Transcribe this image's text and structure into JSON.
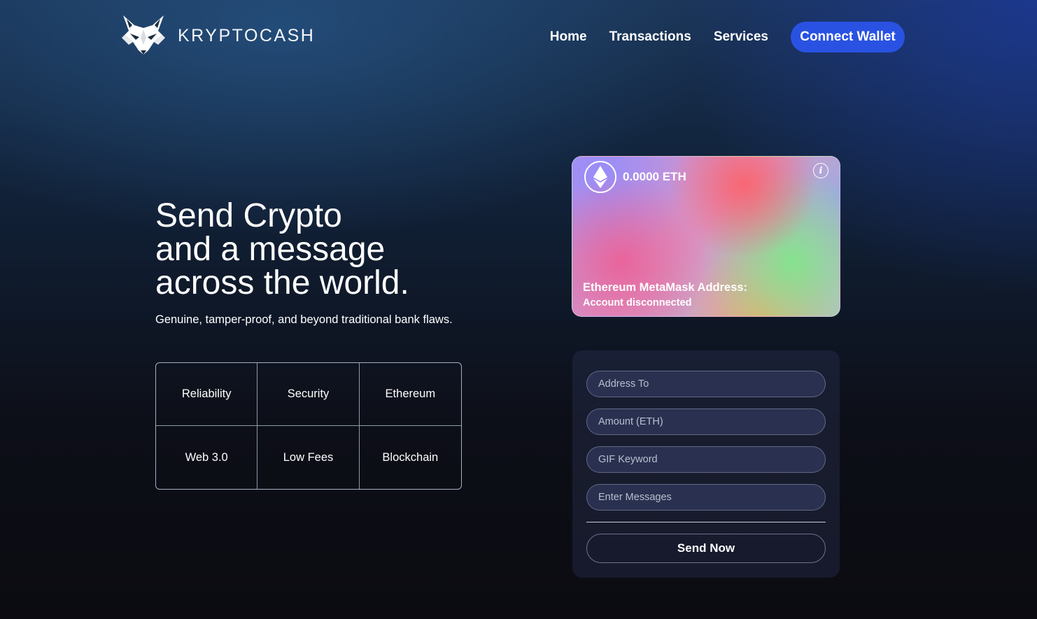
{
  "brand": {
    "name": "KRYPTOCASH",
    "logo_icon": "fox-head-icon"
  },
  "nav": {
    "links": [
      "Home",
      "Transactions",
      "Services"
    ],
    "connect_label": "Connect Wallet",
    "accent_color": "#2952e3"
  },
  "hero": {
    "title_lines": [
      "Send Crypto",
      "and a message",
      "across the world."
    ],
    "subtitle": "Genuine, tamper-proof, and beyond traditional bank flaws."
  },
  "features": [
    "Reliability",
    "Security",
    "Ethereum",
    "Web 3.0",
    "Low Fees",
    "Blockchain"
  ],
  "eth_card": {
    "icon": "ethereum-icon",
    "balance": "0.0000 ETH",
    "info_icon": "info-icon",
    "info_glyph": "i",
    "address_label": "Ethereum MetaMask Address:",
    "address_status": "Account disconnected"
  },
  "form": {
    "address_placeholder": "Address To",
    "amount_placeholder": "Amount (ETH)",
    "gif_placeholder": "GIF Keyword",
    "message_placeholder": "Enter Messages",
    "submit_label": "Send Now"
  }
}
